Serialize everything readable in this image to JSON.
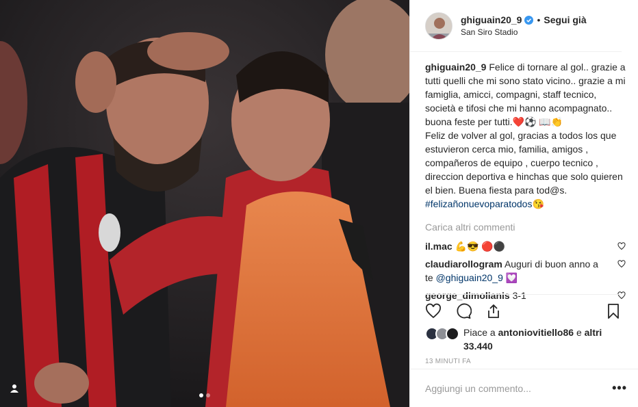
{
  "header": {
    "username": "ghiguain20_9",
    "separator": "•",
    "follow_label": "Segui già",
    "location": "San Siro Stadio"
  },
  "caption": {
    "username": "ghiguain20_9",
    "lines_it": "Felice di tornare al gol.. grazie a tutti quelli che mi sono stato vicino.. grazie a mi famiglia, amicci, compagni, staff tecnico, società e tifosi che mi hanno acompagnato.. buona feste per tutti.❤️⚽ 📖👏",
    "lines_es": "Feliz de volver al gol, gracias a todos los que estuvieron cerca mio, familia, amigos , compañeros de equipo , cuerpo tecnico , direccion deportiva e hinchas que solo quieren el bien. Buena fiesta para tod@s.",
    "hashtag": "#felizañonuevoparatodos",
    "hashtag_emoji": "😘"
  },
  "load_more_label": "Carica altri commenti",
  "comments": [
    {
      "username": "il.mac",
      "text": "💪😎 🔴⚫"
    },
    {
      "username": "claudiarollogram",
      "text": "Auguri di buon anno a te ",
      "mention": "@ghiguain20_9",
      "suffix": " 💟"
    },
    {
      "username": "george_dimolianis",
      "text": "3-1"
    }
  ],
  "likes": {
    "prefix": "Piace a ",
    "user": "antoniovitiello86",
    "middle": " e ",
    "others": "altri 33.440"
  },
  "timestamp": "13 minuti fa",
  "add_comment_placeholder": "Aggiungi un commento...",
  "more_label": "•••",
  "colors": {
    "link": "#003569",
    "verified": "#3897f0",
    "muted": "#999999"
  },
  "icons": [
    "verified-badge-icon",
    "heart-icon",
    "comment-icon",
    "share-icon",
    "bookmark-icon",
    "user-tag-icon"
  ]
}
